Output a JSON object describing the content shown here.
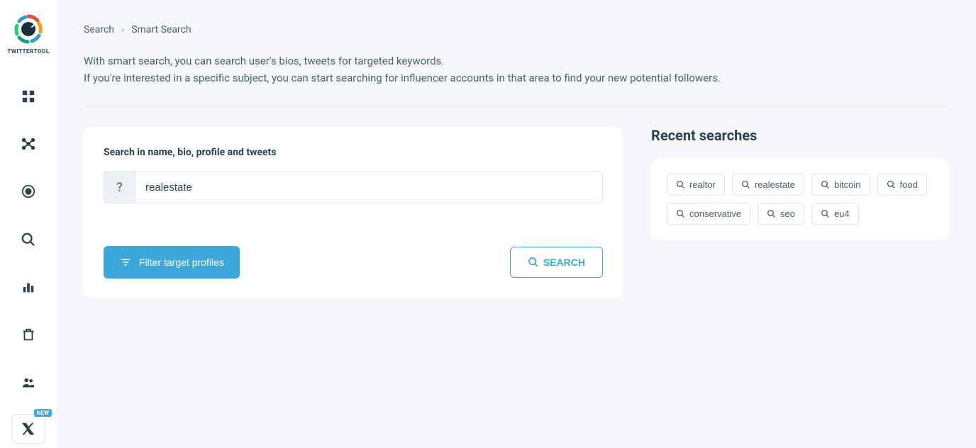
{
  "brand": {
    "name": "TWITTERTOOL",
    "new_badge": "NEW"
  },
  "breadcrumb": {
    "root": "Search",
    "current": "Smart Search"
  },
  "description": {
    "line1": "With smart search, you can search user's bios, tweets for targeted keywords.",
    "line2": "If you're interested in a specific subject, you can start searching for influencer accounts in that area to find your new potential followers."
  },
  "search": {
    "label": "Search in name, bio, profile and tweets",
    "prefix": "?",
    "value": "realestate",
    "filter_label": "Filter target profiles",
    "search_label": "SEARCH"
  },
  "recent": {
    "title": "Recent searches",
    "items": [
      "realtor",
      "realestate",
      "bitcoin",
      "food",
      "conservative",
      "seo",
      "eu4"
    ]
  }
}
